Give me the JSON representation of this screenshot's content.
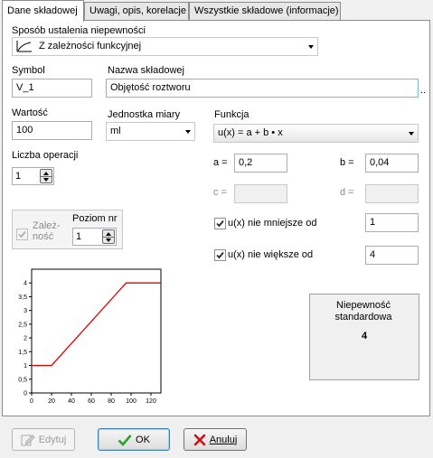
{
  "tabs": [
    {
      "label": "Dane składowej"
    },
    {
      "label": "Uwagi, opis, korelacje"
    },
    {
      "label": "Wszystkie składowe (informacje)"
    }
  ],
  "method": {
    "label": "Sposób ustalenia niepewności",
    "value": "Z zależności funkcyjnej"
  },
  "symbol": {
    "label": "Symbol",
    "value": "V_1"
  },
  "name": {
    "label": "Nazwa składowej",
    "value": "Objętość roztworu",
    "ellipsis": ".."
  },
  "value": {
    "label": "Wartość",
    "value": "100"
  },
  "unit": {
    "label": "Jednostka miary",
    "value": "ml"
  },
  "function": {
    "label": "Funkcja",
    "value": "u(x) = a + b • x"
  },
  "ops": {
    "label": "Liczba operacji",
    "value": "1"
  },
  "coef": {
    "a_label": "a =",
    "a_value": "0,2",
    "b_label": "b =",
    "b_value": "0,04",
    "c_label": "c =",
    "c_value": "",
    "d_label": "d =",
    "d_value": ""
  },
  "dependency": {
    "label": "Zależ-\nność",
    "level_label": "Poziom nr",
    "level_value": "1"
  },
  "min_limit": {
    "label": "u(x) nie mniejsze od",
    "value": "1",
    "checked": true
  },
  "max_limit": {
    "label": "u(x) nie większe od",
    "value": "4",
    "checked": true
  },
  "uncertainty": {
    "label": "Niepewność standardowa",
    "value": "4"
  },
  "buttons": {
    "edit": "Edytuj",
    "ok": "OK",
    "cancel": "Anuluj"
  },
  "chart_data": {
    "type": "line",
    "x": [
      0,
      20,
      95,
      130
    ],
    "y": [
      1,
      1,
      4,
      4
    ],
    "xlim": [
      0,
      130
    ],
    "ylim": [
      0,
      4.5
    ],
    "xticks": [
      0,
      20,
      40,
      60,
      80,
      100,
      120
    ],
    "yticks": [
      0,
      0.5,
      1,
      1.5,
      2,
      2.5,
      3,
      3.5,
      4
    ],
    "ytick_labels": [
      "0",
      "0,5",
      "1",
      "1,5",
      "2",
      "2,5",
      "3",
      "3,5",
      "4"
    ],
    "line_color": "#e00000",
    "grid": false
  },
  "colors": {
    "accent": "#3c7fb1",
    "check": "#2a2a2a"
  }
}
